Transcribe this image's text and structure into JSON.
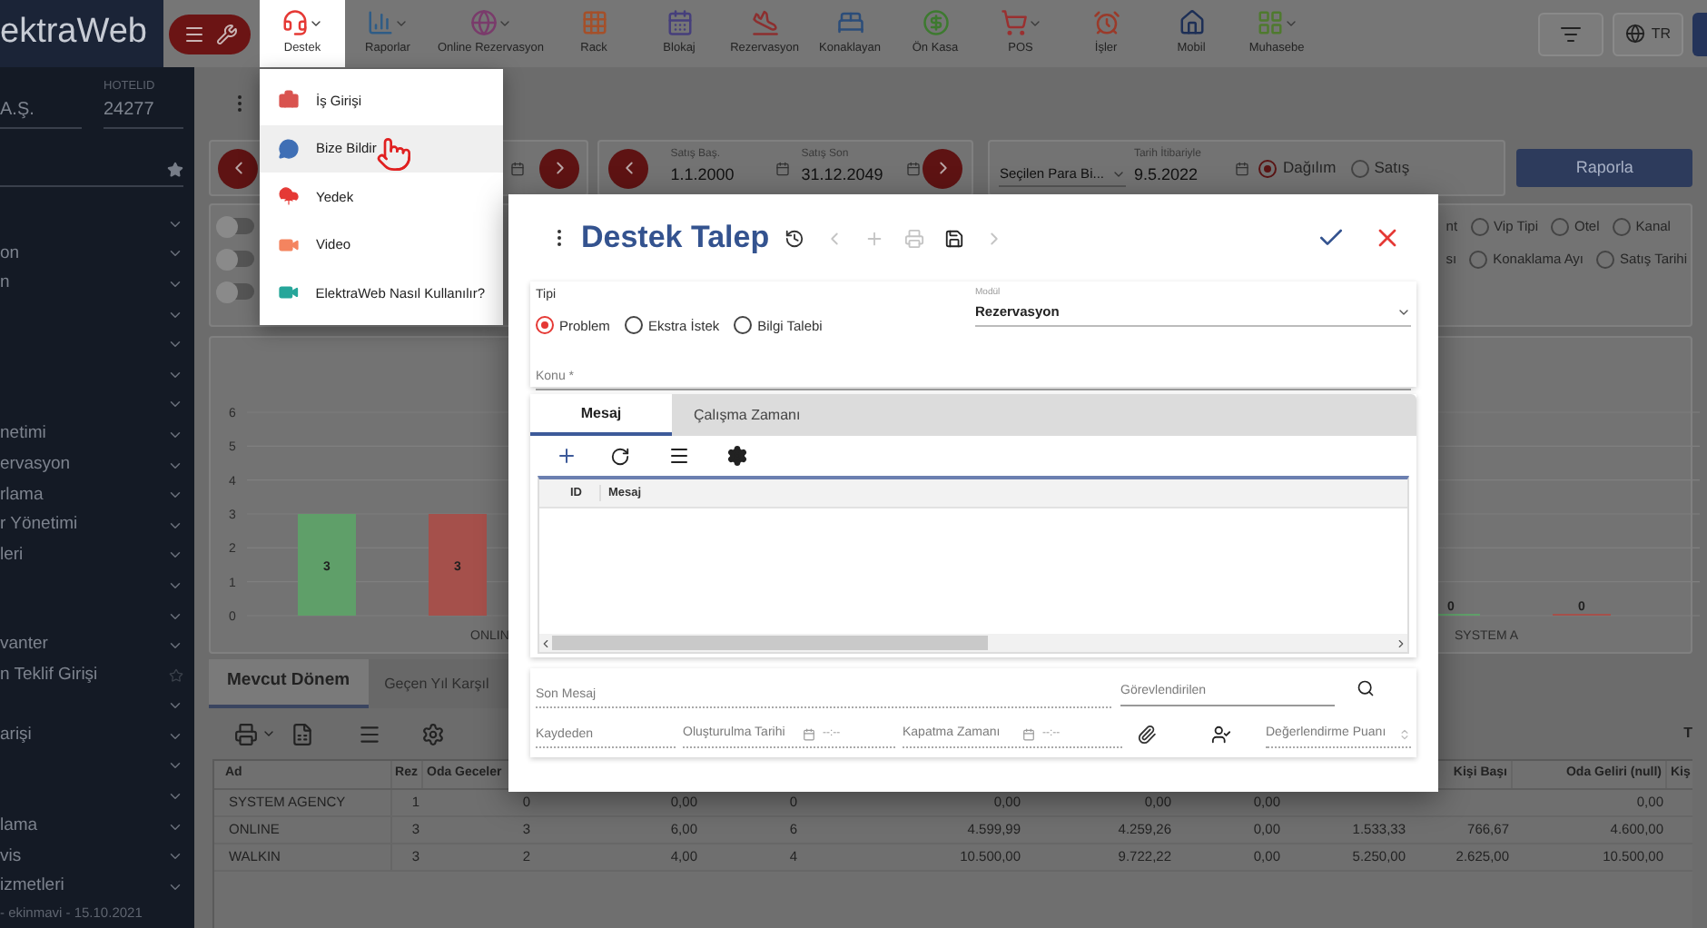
{
  "topbar": {
    "logo": "ektraWeb",
    "menu_items": [
      {
        "label": "Destek",
        "selected": true,
        "caret": true
      },
      {
        "label": "Raporlar",
        "selected": false,
        "caret": true
      },
      {
        "label": "Online Rezervasyon",
        "selected": false,
        "caret": true
      },
      {
        "label": "Rack",
        "selected": false,
        "caret": false
      },
      {
        "label": "Blokaj",
        "selected": false,
        "caret": false
      },
      {
        "label": "Rezervasyon",
        "selected": false,
        "caret": false
      },
      {
        "label": "Konaklayan",
        "selected": false,
        "caret": false
      },
      {
        "label": "Ön Kasa",
        "selected": false,
        "caret": false
      },
      {
        "label": "POS",
        "selected": false,
        "caret": true
      },
      {
        "label": "İşler",
        "selected": false,
        "caret": false
      },
      {
        "label": "Mobil",
        "selected": false,
        "caret": false
      },
      {
        "label": "Muhasebe",
        "selected": false,
        "caret": true
      }
    ],
    "language": "TR"
  },
  "sidebar": {
    "company": "A.Ş.",
    "hotel_id_label": "HOTELID",
    "hotel_id": "24277",
    "items": [
      {
        "kind": "chevron"
      },
      {
        "label": "on",
        "kind": "chevron"
      },
      {
        "label": "n",
        "kind": "chevron"
      },
      {
        "kind": "chevron"
      },
      {
        "kind": "chevron"
      },
      {
        "kind": "chevron"
      },
      {
        "kind": "chevron"
      },
      {
        "label": "netimi",
        "kind": "chevron"
      },
      {
        "label": "ervasyon",
        "kind": "chevron"
      },
      {
        "label": "rlama",
        "kind": "chevron"
      },
      {
        "label": "r Yönetimi",
        "kind": "chevron"
      },
      {
        "label": "leri",
        "kind": "chevron"
      },
      {
        "kind": "chevron"
      },
      {
        "kind": "chevron"
      },
      {
        "label": "vanter",
        "kind": "chevron"
      },
      {
        "label": "n Teklif Girişi",
        "kind": "star"
      },
      {
        "kind": "chevron"
      },
      {
        "label": "arişi",
        "kind": "chevron"
      },
      {
        "kind": "chevron"
      },
      {
        "kind": "chevron"
      },
      {
        "label": "lama",
        "kind": "chevron"
      },
      {
        "label": "vis",
        "kind": "chevron"
      },
      {
        "label": "izmetleri",
        "kind": "chevron"
      }
    ],
    "footer": "- ekinmavi - 15.10.2021"
  },
  "support_menu": {
    "items": [
      {
        "label": "İş Girişi",
        "selected": false
      },
      {
        "label": "Bize Bildir",
        "selected": true
      },
      {
        "label": "Yedek",
        "selected": false
      },
      {
        "label": "Video",
        "selected": false
      },
      {
        "label": "ElektraWeb Nasıl Kullanılır?",
        "selected": false
      }
    ]
  },
  "filters": {
    "sales_start": {
      "label": "Satış Baş.",
      "value": "1.1.2000"
    },
    "sales_end": {
      "label": "Satış Son",
      "value": "31.12.2049"
    },
    "currency": {
      "value": "Seçilen Para Bi..."
    },
    "as_of": {
      "label": "Tarih İtibariyle",
      "value": "9.5.2022"
    },
    "modes": [
      {
        "label": "Dağılım",
        "selected": true
      },
      {
        "label": "Satış",
        "selected": false
      }
    ],
    "report_button": "Raporla"
  },
  "options": {
    "switches": [
      {
        "on": false
      },
      {
        "on": false
      },
      {
        "on": false
      }
    ],
    "group_rows": [
      [
        {
          "kind": "text",
          "label": "nt"
        },
        {
          "kind": "radio",
          "label": "Vip Tipi",
          "selected": false
        },
        {
          "kind": "radio",
          "label": "Otel",
          "selected": false
        },
        {
          "kind": "radio",
          "label": "Kanal",
          "selected": false
        }
      ],
      [
        {
          "kind": "text",
          "label": "sı"
        },
        {
          "kind": "radio",
          "label": "Konaklama Ayı",
          "selected": false
        },
        {
          "kind": "radio",
          "label": "Satış Tarihi",
          "selected": false
        }
      ]
    ]
  },
  "chart": {
    "chart_data": {
      "type": "bar",
      "categories": [
        "ONLIN",
        "SYSTEM A"
      ],
      "series": [
        {
          "color": "#5f9f69",
          "values": [
            3,
            0
          ]
        },
        {
          "color": "#a5504b",
          "values": [
            3,
            0
          ]
        }
      ],
      "ylim": [
        0,
        6
      ],
      "yticks": [
        0,
        1,
        2,
        3,
        4,
        5,
        6
      ],
      "grid": true,
      "data_labels": true
    }
  },
  "result_tabs": [
    {
      "label": "Mevcut Dönem",
      "selected": true
    },
    {
      "label": "Geçen Yıl Karşıl",
      "selected": false
    }
  ],
  "toolbar_text": "T",
  "table": {
    "columns": [
      "Ad",
      "Rez",
      "Oda Geceler",
      "",
      "",
      "",
      "",
      "",
      "",
      "Kişi Başı",
      "Oda Geliri (null)",
      "Kiş"
    ],
    "rows": [
      [
        "SYSTEM AGENCY",
        "1",
        "0",
        "0,00",
        "0",
        "0,00",
        "0,00",
        "0,00",
        null,
        null,
        "0,00"
      ],
      [
        "ONLINE",
        "3",
        "3",
        "6,00",
        "6",
        "4.599,99",
        "4.259,26",
        "0,00",
        "1.533,33",
        "766,67",
        "4.600,00"
      ],
      [
        "WALKIN",
        "3",
        "2",
        "4,00",
        "4",
        "10.500,00",
        "9.722,22",
        "0,00",
        "5.250,00",
        "2.625,00",
        "10.500,00"
      ]
    ]
  },
  "dialog": {
    "title": "Destek Talep",
    "actions": [
      {
        "kind": "prev",
        "disabled": true
      },
      {
        "kind": "add",
        "disabled": true
      },
      {
        "kind": "print",
        "disabled": true
      },
      {
        "kind": "save",
        "disabled": false
      },
      {
        "kind": "next",
        "disabled": true
      }
    ],
    "type_label": "Tipi",
    "types": [
      {
        "label": "Problem",
        "selected": true
      },
      {
        "label": "Ekstra İstek",
        "selected": false
      },
      {
        "label": "Bilgi Talebi",
        "selected": false
      }
    ],
    "module": {
      "label": "Modül",
      "value": "Rezervasyon"
    },
    "subject": {
      "placeholder": "Konu *"
    },
    "tabs": [
      {
        "label": "Mesaj",
        "selected": true
      },
      {
        "label": "Çalışma Zamanı",
        "selected": false
      }
    ],
    "grid_columns": [
      "ID",
      "Mesaj"
    ],
    "last_message": {
      "placeholder": "Son Mesaj"
    },
    "assignee": {
      "placeholder": "Görevlendirilen"
    },
    "recorded_by": {
      "placeholder": "Kaydeden"
    },
    "created": {
      "placeholder": "Oluşturulma Tarihi",
      "time": "--:--"
    },
    "closed": {
      "placeholder": "Kapatma Zamanı",
      "time": "--:--"
    },
    "rating": {
      "placeholder": "Değerlendirme Puanı"
    }
  }
}
